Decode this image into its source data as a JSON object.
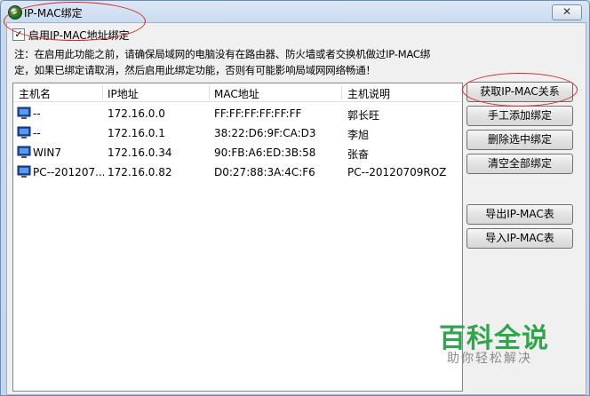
{
  "window": {
    "title": "IP-MAC绑定",
    "close_glyph": "✕"
  },
  "enable_binding": {
    "label": "启用IP-MAC地址绑定",
    "checked": true,
    "check_glyph": "✓"
  },
  "note": {
    "line1": "注：在启用此功能之前，请确保局域网的电脑没有在路由器、防火墙或者交换机做过IP-MAC绑",
    "line2": "定，如果已绑定请取消，然后启用此绑定功能，否则有可能影响局域网网络畅通！"
  },
  "table": {
    "headers": [
      "主机名",
      "IP地址",
      "MAC地址",
      "主机说明"
    ],
    "rows": [
      {
        "host": "--",
        "ip": "172.16.0.0",
        "mac": "FF:FF:FF:FF:FF:FF",
        "desc": "郭长旺"
      },
      {
        "host": "--",
        "ip": "172.16.0.1",
        "mac": "38:22:D6:9F:CA:D3",
        "desc": "李旭"
      },
      {
        "host": "WIN7",
        "ip": "172.16.0.34",
        "mac": "90:FB:A6:ED:3B:58",
        "desc": "张奋"
      },
      {
        "host": "PC--201207...",
        "ip": "172.16.0.82",
        "mac": "D0:27:88:3A:4C:F6",
        "desc": "PC--20120709ROZ"
      }
    ]
  },
  "buttons": {
    "get_relation": "获取IP-MAC关系",
    "manual_add": "手工添加绑定",
    "delete_selected": "删除选中绑定",
    "clear_all": "清空全部绑定",
    "export": "导出IP-MAC表",
    "import": "导入IP-MAC表"
  },
  "watermark": {
    "title": "百科全说",
    "subtitle": "助你轻松解决"
  },
  "colors": {
    "annotation_red": "#d8262c",
    "watermark_green": "#2fa64a"
  }
}
